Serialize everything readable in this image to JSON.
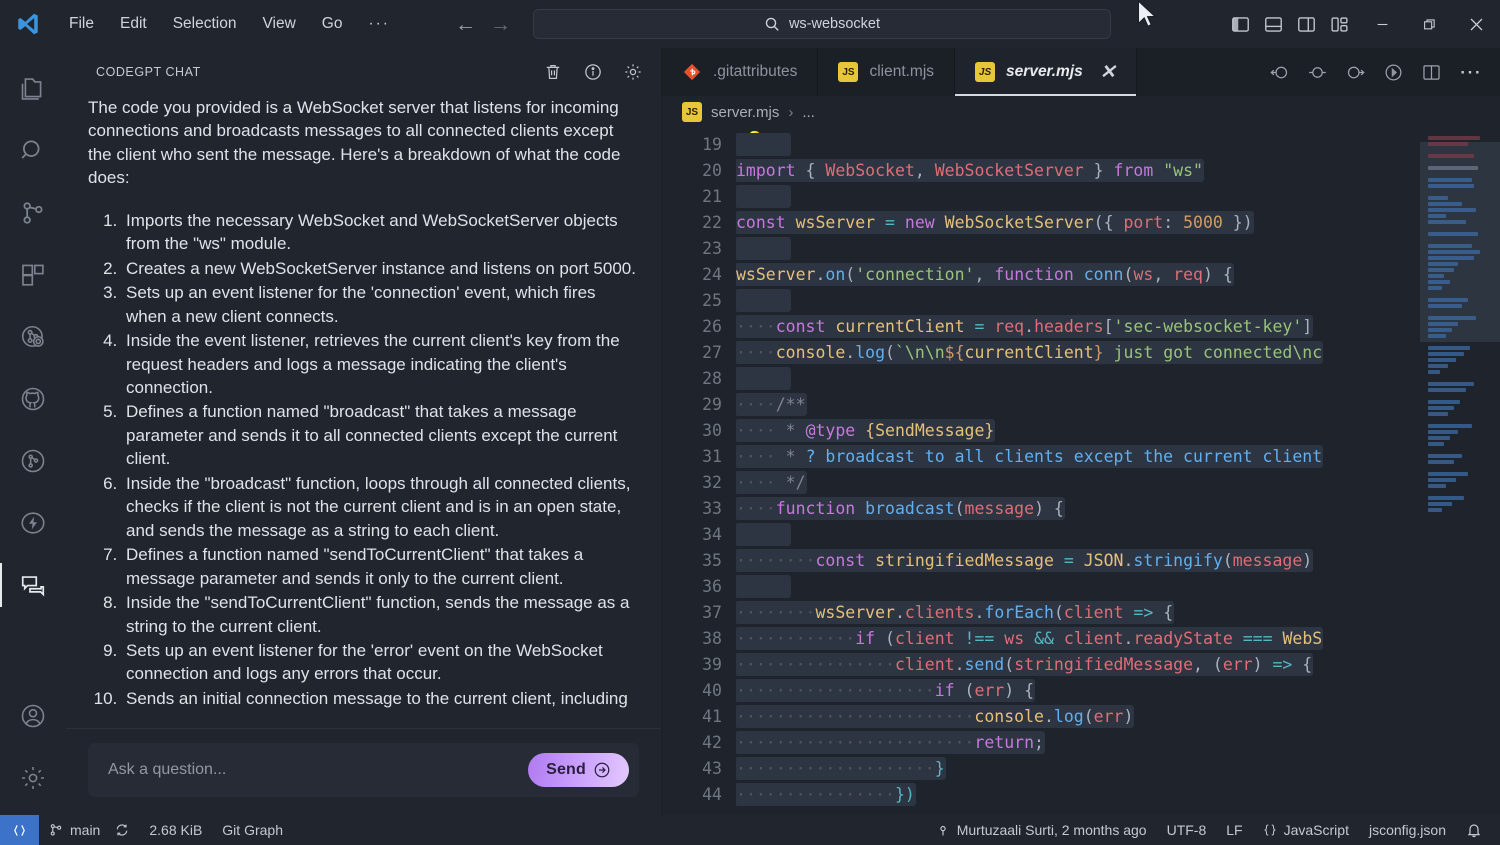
{
  "titlebar": {
    "logo_icon": "vscode-logo-icon",
    "menu": [
      "File",
      "Edit",
      "Selection",
      "View",
      "Go"
    ],
    "menu_overflow": "···",
    "nav_back_icon": "arrow-left-icon",
    "nav_forward_icon": "arrow-right-icon",
    "command_center": {
      "icon": "search-icon",
      "value": "ws-websocket"
    },
    "layout_icons": [
      "toggle-primary-sidebar-icon",
      "toggle-panel-icon",
      "toggle-secondary-sidebar-icon",
      "customize-layout-icon"
    ],
    "window_controls": {
      "minimize": "—",
      "maximize": "restore-icon",
      "close": "✕"
    }
  },
  "activitybar": {
    "items": [
      {
        "name": "explorer",
        "icon": "files-icon",
        "active": false
      },
      {
        "name": "search",
        "icon": "search-icon",
        "active": false
      },
      {
        "name": "source-control",
        "icon": "source-control-icon",
        "active": false
      },
      {
        "name": "extensions",
        "icon": "extensions-icon",
        "active": false
      },
      {
        "name": "remote-explorer",
        "icon": "remote-explorer-icon",
        "active": false
      },
      {
        "name": "github",
        "icon": "github-icon",
        "active": false
      },
      {
        "name": "git-graph",
        "icon": "git-graph-icon",
        "active": false
      },
      {
        "name": "thunder-client",
        "icon": "thunder-bolt-icon",
        "active": false
      },
      {
        "name": "codegpt-chat",
        "icon": "chat-icon",
        "active": true
      }
    ],
    "bottom": [
      {
        "name": "accounts",
        "icon": "account-icon"
      },
      {
        "name": "settings",
        "icon": "gear-icon"
      }
    ]
  },
  "chat": {
    "title": "CODEGPT CHAT",
    "actions": [
      {
        "name": "clear-chat",
        "icon": "trash-icon"
      },
      {
        "name": "chat-info",
        "icon": "info-icon"
      },
      {
        "name": "chat-settings",
        "icon": "gear-icon"
      }
    ],
    "message": {
      "intro": "The code you provided is a WebSocket server that listens for incoming connections and broadcasts messages to all connected clients except the client who sent the message. Here's a breakdown of what the code does:",
      "steps": [
        "Imports the necessary WebSocket and WebSocketServer objects from the \"ws\" module.",
        "Creates a new WebSocketServer instance and listens on port 5000.",
        "Sets up an event listener for the 'connection' event, which fires when a new client connects.",
        "Inside the event listener, retrieves the current client's key from the request headers and logs a message indicating the client's connection.",
        "Defines a function named \"broadcast\" that takes a message parameter and sends it to all connected clients except the current client.",
        "Inside the \"broadcast\" function, loops through all connected clients, checks if the client is not the current client and is in an open state, and sends the message as a string to each client.",
        "Defines a function named \"sendToCurrentClient\" that takes a message parameter and sends it only to the current client.",
        "Inside the \"sendToCurrentClient\" function, sends the message as a string to the current client.",
        "Sets up an event listener for the 'error' event on the WebSocket connection and logs any errors that occur.",
        "Sends an initial connection message to the current client, including"
      ]
    },
    "input": {
      "placeholder": "Ask a question...",
      "send_label": "Send",
      "send_icon": "arrow-right-circle-icon"
    }
  },
  "editor": {
    "tabs": [
      {
        "label": ".gitattributes",
        "icon": "git-file-icon",
        "active": false,
        "closable": false
      },
      {
        "label": "client.mjs",
        "icon": "js-file-icon",
        "active": false,
        "closable": false
      },
      {
        "label": "server.mjs",
        "icon": "js-file-icon",
        "active": true,
        "closable": true,
        "close_icon": "close-icon"
      }
    ],
    "actions": [
      {
        "name": "go-back-symbol",
        "icon": "arrow-circle-left-icon"
      },
      {
        "name": "reference-symbol",
        "icon": "circle-dash-icon"
      },
      {
        "name": "go-forward-symbol",
        "icon": "arrow-circle-right-icon"
      },
      {
        "name": "run-debug",
        "icon": "play-circle-icon"
      },
      {
        "name": "split-editor",
        "icon": "split-editor-icon"
      },
      {
        "name": "more-actions",
        "icon": "ellipsis-icon"
      }
    ],
    "breadcrumb": {
      "icon": "js-file-icon",
      "file": "server.mjs",
      "separator": "›",
      "tail": "..."
    },
    "first_line_number": 19,
    "code_lines": [
      {
        "n": 19,
        "tokens": []
      },
      {
        "n": 20,
        "tokens": [
          [
            "kw",
            "import"
          ],
          [
            "punc",
            " { "
          ],
          [
            "prop",
            "WebSocket"
          ],
          [
            "punc",
            ", "
          ],
          [
            "prop",
            "WebSocketServer"
          ],
          [
            "punc",
            " } "
          ],
          [
            "kw",
            "from"
          ],
          [
            "punc",
            " "
          ],
          [
            "str",
            "\"ws\""
          ]
        ]
      },
      {
        "n": 21,
        "tokens": []
      },
      {
        "n": 22,
        "tokens": [
          [
            "kw",
            "const"
          ],
          [
            "punc",
            " "
          ],
          [
            "var",
            "wsServer"
          ],
          [
            "punc",
            " "
          ],
          [
            "op",
            "="
          ],
          [
            "punc",
            " "
          ],
          [
            "kw",
            "new"
          ],
          [
            "punc",
            " "
          ],
          [
            "cls",
            "WebSocketServer"
          ],
          [
            "punc",
            "({ "
          ],
          [
            "prop",
            "port"
          ],
          [
            "punc",
            ": "
          ],
          [
            "num",
            "5000"
          ],
          [
            "punc",
            " })"
          ]
        ]
      },
      {
        "n": 23,
        "tokens": []
      },
      {
        "n": 24,
        "tokens": [
          [
            "var",
            "wsServer"
          ],
          [
            "punc",
            "."
          ],
          [
            "fn",
            "on"
          ],
          [
            "punc",
            "("
          ],
          [
            "str",
            "'connection'"
          ],
          [
            "punc",
            ", "
          ],
          [
            "kw",
            "function"
          ],
          [
            "punc",
            " "
          ],
          [
            "fn",
            "conn"
          ],
          [
            "punc",
            "("
          ],
          [
            "prop",
            "ws"
          ],
          [
            "punc",
            ", "
          ],
          [
            "prop",
            "req"
          ],
          [
            "punc",
            ") {"
          ]
        ]
      },
      {
        "n": 25,
        "tokens": []
      },
      {
        "n": 26,
        "tokens": [
          [
            "ind",
            "····"
          ],
          [
            "kw",
            "const"
          ],
          [
            "punc",
            " "
          ],
          [
            "var",
            "currentClient"
          ],
          [
            "punc",
            " "
          ],
          [
            "op",
            "="
          ],
          [
            "punc",
            " "
          ],
          [
            "prop",
            "req"
          ],
          [
            "punc",
            "."
          ],
          [
            "prop",
            "headers"
          ],
          [
            "punc",
            "["
          ],
          [
            "str",
            "'sec-websocket-key'"
          ],
          [
            "punc",
            "]"
          ]
        ]
      },
      {
        "n": 27,
        "tokens": [
          [
            "ind",
            "····"
          ],
          [
            "var",
            "console"
          ],
          [
            "punc",
            "."
          ],
          [
            "fn",
            "log"
          ],
          [
            "punc",
            "("
          ],
          [
            "str",
            "`\\n\\n"
          ],
          [
            "num",
            "${"
          ],
          [
            "var",
            "currentClient"
          ],
          [
            "num",
            "}"
          ],
          [
            "str",
            " just got connected\\nc"
          ]
        ]
      },
      {
        "n": 28,
        "tokens": []
      },
      {
        "n": 29,
        "tokens": [
          [
            "ind",
            "····"
          ],
          [
            "cmt",
            "/**"
          ]
        ]
      },
      {
        "n": 30,
        "tokens": [
          [
            "ind",
            "····"
          ],
          [
            "cmt",
            " * "
          ],
          [
            "cmtk",
            "@type"
          ],
          [
            "cmt",
            " "
          ],
          [
            "var",
            "{SendMessage}"
          ]
        ]
      },
      {
        "n": 31,
        "tokens": [
          [
            "ind",
            "····"
          ],
          [
            "cmt",
            " * "
          ],
          [
            "cmtt",
            "? broadcast to all clients except the current client"
          ]
        ]
      },
      {
        "n": 32,
        "tokens": [
          [
            "ind",
            "····"
          ],
          [
            "cmt",
            " */"
          ]
        ]
      },
      {
        "n": 33,
        "tokens": [
          [
            "ind",
            "····"
          ],
          [
            "kw",
            "function"
          ],
          [
            "punc",
            " "
          ],
          [
            "fn",
            "broadcast"
          ],
          [
            "punc",
            "("
          ],
          [
            "prop",
            "message"
          ],
          [
            "punc",
            ") {"
          ]
        ]
      },
      {
        "n": 34,
        "tokens": []
      },
      {
        "n": 35,
        "tokens": [
          [
            "ind",
            "········"
          ],
          [
            "kw",
            "const"
          ],
          [
            "punc",
            " "
          ],
          [
            "var",
            "stringifiedMessage"
          ],
          [
            "punc",
            " "
          ],
          [
            "op",
            "="
          ],
          [
            "punc",
            " "
          ],
          [
            "cls",
            "JSON"
          ],
          [
            "punc",
            "."
          ],
          [
            "fn",
            "stringify"
          ],
          [
            "punc",
            "("
          ],
          [
            "prop",
            "message"
          ],
          [
            "punc",
            ")"
          ]
        ]
      },
      {
        "n": 36,
        "tokens": []
      },
      {
        "n": 37,
        "tokens": [
          [
            "ind",
            "········"
          ],
          [
            "var",
            "wsServer"
          ],
          [
            "punc",
            "."
          ],
          [
            "prop",
            "clients"
          ],
          [
            "punc",
            "."
          ],
          [
            "fn",
            "forEach"
          ],
          [
            "punc",
            "("
          ],
          [
            "prop",
            "client"
          ],
          [
            "punc",
            " "
          ],
          [
            "op",
            "=>"
          ],
          [
            "punc",
            " {"
          ]
        ]
      },
      {
        "n": 38,
        "tokens": [
          [
            "ind",
            "············"
          ],
          [
            "kw",
            "if"
          ],
          [
            "punc",
            " ("
          ],
          [
            "prop",
            "client"
          ],
          [
            "punc",
            " "
          ],
          [
            "op",
            "!=="
          ],
          [
            "punc",
            " "
          ],
          [
            "prop",
            "ws"
          ],
          [
            "punc",
            " "
          ],
          [
            "op",
            "&&"
          ],
          [
            "punc",
            " "
          ],
          [
            "prop",
            "client"
          ],
          [
            "punc",
            "."
          ],
          [
            "prop",
            "readyState"
          ],
          [
            "punc",
            " "
          ],
          [
            "op",
            "==="
          ],
          [
            "punc",
            " "
          ],
          [
            "cls",
            "WebS"
          ]
        ]
      },
      {
        "n": 39,
        "tokens": [
          [
            "ind",
            "················"
          ],
          [
            "prop",
            "client"
          ],
          [
            "punc",
            "."
          ],
          [
            "fn",
            "send"
          ],
          [
            "punc",
            "("
          ],
          [
            "prop",
            "stringifiedMessage"
          ],
          [
            "punc",
            ", ("
          ],
          [
            "prop",
            "err"
          ],
          [
            "punc",
            ") "
          ],
          [
            "op",
            "=>"
          ],
          [
            "punc",
            " {"
          ]
        ]
      },
      {
        "n": 40,
        "tokens": [
          [
            "ind",
            "····················"
          ],
          [
            "kw",
            "if"
          ],
          [
            "punc",
            " ("
          ],
          [
            "prop",
            "err"
          ],
          [
            "punc",
            ") {"
          ]
        ]
      },
      {
        "n": 41,
        "tokens": [
          [
            "ind",
            "························"
          ],
          [
            "var",
            "console"
          ],
          [
            "punc",
            "."
          ],
          [
            "fn",
            "log"
          ],
          [
            "punc",
            "("
          ],
          [
            "prop",
            "err"
          ],
          [
            "punc",
            ")"
          ]
        ]
      },
      {
        "n": 42,
        "tokens": [
          [
            "ind",
            "························"
          ],
          [
            "kw",
            "return"
          ],
          [
            "punc",
            ";"
          ]
        ]
      },
      {
        "n": 43,
        "tokens": [
          [
            "ind",
            "····················"
          ],
          [
            "op",
            "}"
          ]
        ]
      },
      {
        "n": 44,
        "tokens": [
          [
            "ind",
            "················"
          ],
          [
            "op",
            "})"
          ]
        ]
      }
    ],
    "lightbulb_icon": "lightbulb-icon"
  },
  "statusbar": {
    "remote_icon": "remote-window-icon",
    "left": [
      {
        "name": "git-branch",
        "icon": "branch-icon",
        "label": "main"
      },
      {
        "name": "sync-changes",
        "icon": "sync-icon",
        "label": ""
      },
      {
        "name": "file-size",
        "icon": "",
        "label": "2.68 KiB"
      },
      {
        "name": "git-graph",
        "icon": "",
        "label": "Git Graph"
      }
    ],
    "right": [
      {
        "name": "git-blame",
        "icon": "git-commit-icon",
        "label": "Murtuzaali Surti, 2 months ago"
      },
      {
        "name": "encoding",
        "icon": "",
        "label": "UTF-8"
      },
      {
        "name": "eol",
        "icon": "",
        "label": "LF"
      },
      {
        "name": "language-mode",
        "icon": "braces-icon",
        "label": "JavaScript"
      },
      {
        "name": "jsconfig",
        "icon": "",
        "label": "jsconfig.json"
      },
      {
        "name": "notifications",
        "icon": "bell-icon",
        "label": ""
      }
    ]
  },
  "colors": {
    "accent_blue": "#3c72c8",
    "send_purple": "#c39bf5",
    "js_yellow": "#e8c63a",
    "git_orange": "#e8502e",
    "editor_bg": "#1f242c",
    "panel_bg": "#21262e"
  }
}
